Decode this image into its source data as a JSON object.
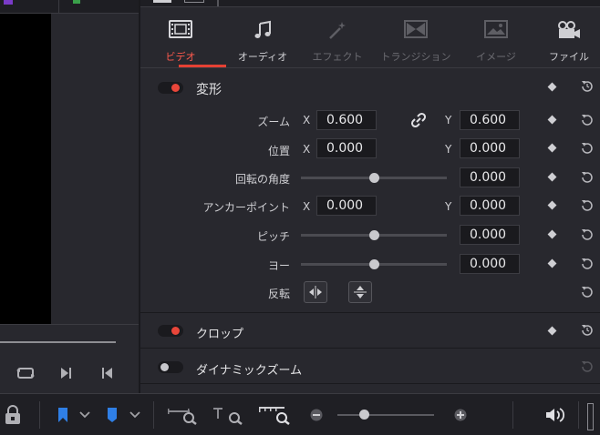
{
  "tabs": [
    {
      "label": "ビデオ",
      "icon": "film-icon",
      "state": "active"
    },
    {
      "label": "オーディオ",
      "icon": "music-note-icon",
      "state": "normal"
    },
    {
      "label": "エフェクト",
      "icon": "magic-wand-icon",
      "state": "disabled"
    },
    {
      "label": "トランジション",
      "icon": "transition-icon",
      "state": "disabled"
    },
    {
      "label": "イメージ",
      "icon": "image-icon",
      "state": "disabled"
    },
    {
      "label": "ファイル",
      "icon": "film-camera-icon",
      "state": "normal"
    }
  ],
  "transform": {
    "title": "変形",
    "enabled": true,
    "zoom": {
      "label": "ズーム",
      "x_axis": "X",
      "x": "0.600",
      "y_axis": "Y",
      "y": "0.600",
      "linked": true
    },
    "position": {
      "label": "位置",
      "x_axis": "X",
      "x": "0.000",
      "y_axis": "Y",
      "y": "0.000"
    },
    "rotation": {
      "label": "回転の角度",
      "value": "0.000",
      "slider": 0.5
    },
    "anchor": {
      "label": "アンカーポイント",
      "x_axis": "X",
      "x": "0.000",
      "y_axis": "Y",
      "y": "0.000"
    },
    "pitch": {
      "label": "ピッチ",
      "value": "0.000",
      "slider": 0.5
    },
    "yaw": {
      "label": "ヨー",
      "value": "0.000",
      "slider": 0.5
    },
    "flip": {
      "label": "反転"
    }
  },
  "crop": {
    "title": "クロップ",
    "enabled": true
  },
  "dynamic_zoom": {
    "title": "ダイナミックズーム",
    "enabled": false
  },
  "colors": {
    "accent": "#e64134",
    "background": "#28282e",
    "field": "#1a1a1e"
  },
  "timeline_zoom": {
    "slider": 0.25
  }
}
